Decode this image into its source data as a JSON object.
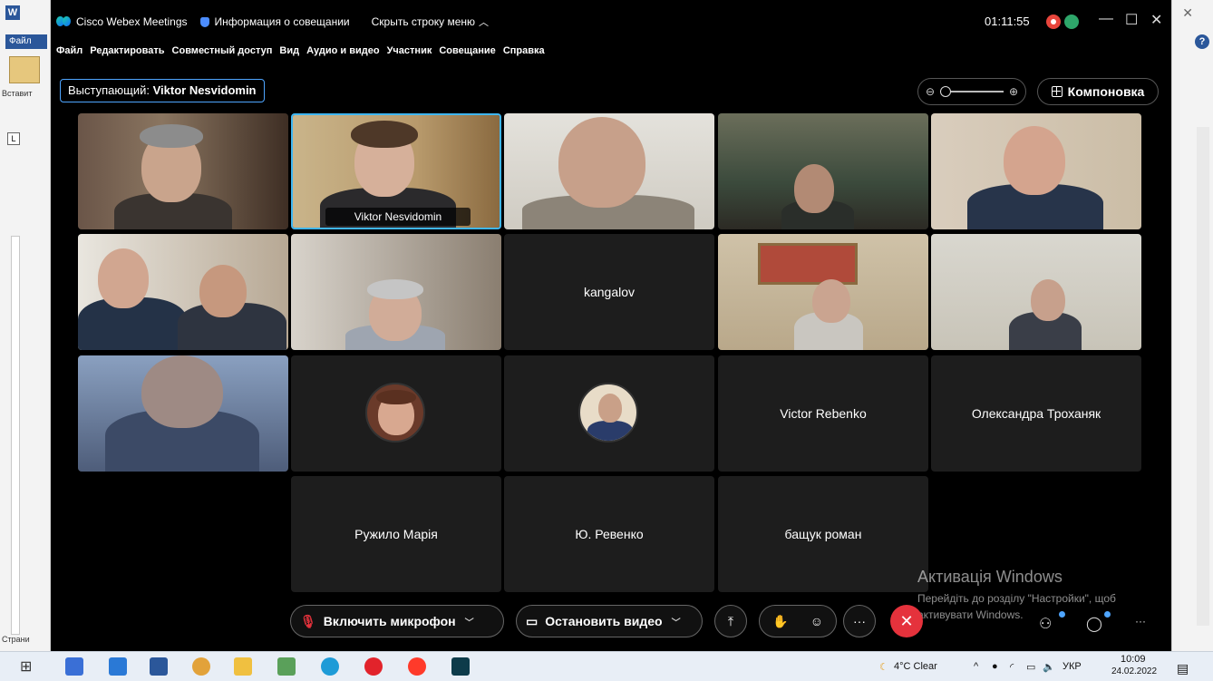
{
  "word": {
    "file_tab": "Файл",
    "paste_label": "Вставит",
    "ruler_btn": "L",
    "status_label": "Страни"
  },
  "webex": {
    "app_title": "Cisco Webex Meetings",
    "meeting_info": "Информация о совещании",
    "hide_menu": "Скрыть строку меню",
    "timer": "01:11:55",
    "menu": [
      "Файл",
      "Редактировать",
      "Совместный доступ",
      "Вид",
      "Аудио и видео",
      "Участник",
      "Совещание",
      "Справка"
    ],
    "speaker_prefix": "Выступающий:",
    "speaker_name": "Viktor Nesvidomin",
    "layout_label": "Компоновка"
  },
  "tiles": {
    "active_caption": "Viktor Nesvidomin",
    "kangalov": "kangalov",
    "rebenko": "Victor Rebenko",
    "trokhanyak": "Олександра Троханяк",
    "ruzhylo": "Ружило Марія",
    "revenko": "Ю. Ревенко",
    "bashchuk": "бащук роман"
  },
  "toolbar": {
    "mic_label": "Включить микрофон",
    "video_label": "Остановить видео"
  },
  "activation": {
    "title": "Активація Windows",
    "line1": "Перейдіть до розділу \"Настройки\", щоб",
    "line2": "активувати Windows."
  },
  "taskbar": {
    "weather": "4°C  Clear",
    "lang": "УКР",
    "time": "10:09",
    "date": "24.02.2022"
  },
  "colors": {
    "accent_blue": "#3fb6f2",
    "end_red": "#e5323c",
    "record_red": "#e8453c"
  }
}
